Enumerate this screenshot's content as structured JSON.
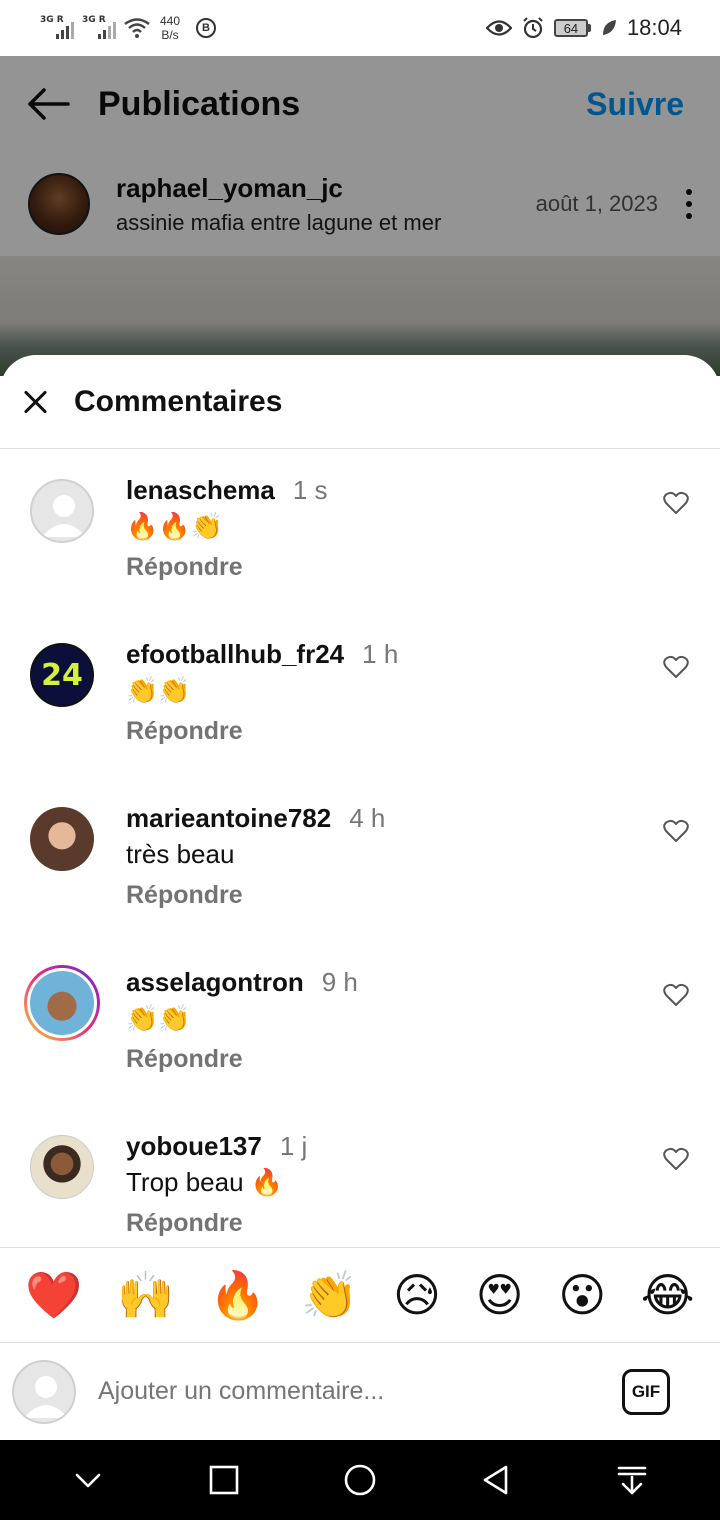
{
  "status_bar": {
    "net1": "3G R",
    "net2": "3G R",
    "speed_value": "440",
    "speed_unit": "B/s",
    "b_badge": "B",
    "battery": "64",
    "time": "18:04"
  },
  "header": {
    "title": "Publications",
    "follow_label": "Suivre"
  },
  "post": {
    "username": "raphael_yoman_jc",
    "location": "assinie mafia entre lagune et mer",
    "date": "août 1, 2023"
  },
  "sheet": {
    "title": "Commentaires"
  },
  "comments": [
    {
      "username": "lenaschema",
      "time": "1 s",
      "text": "🔥🔥👏",
      "reply_label": "Répondre"
    },
    {
      "username": "efootballhub_fr24",
      "time": "1 h",
      "text": "👏👏",
      "reply_label": "Répondre",
      "avatar_text": "24"
    },
    {
      "username": "marieantoine782",
      "time": "4 h",
      "text": "très beau",
      "reply_label": "Répondre"
    },
    {
      "username": "asselagontron",
      "time": "9 h",
      "text": "👏👏",
      "reply_label": "Répondre"
    },
    {
      "username": "yoboue137",
      "time": "1 j",
      "text": "Trop beau 🔥",
      "reply_label": "Répondre"
    }
  ],
  "emoji_bar": [
    "❤️",
    "🙌",
    "🔥",
    "👏",
    "😥",
    "😍",
    "😮",
    "😂"
  ],
  "composer": {
    "placeholder": "Ajouter un commentaire...",
    "gif_label": "GIF"
  },
  "colors": {
    "accent": "#0095f6",
    "reply_gray": "#737373",
    "nav_bg": "#000000"
  },
  "icons": [
    "back-arrow-icon",
    "more-options-icon",
    "close-icon",
    "heart-outline-icon",
    "gif-icon",
    "nav-collapse-icon",
    "nav-recents-icon",
    "nav-home-icon",
    "nav-back-icon",
    "nav-notifications-icon"
  ]
}
